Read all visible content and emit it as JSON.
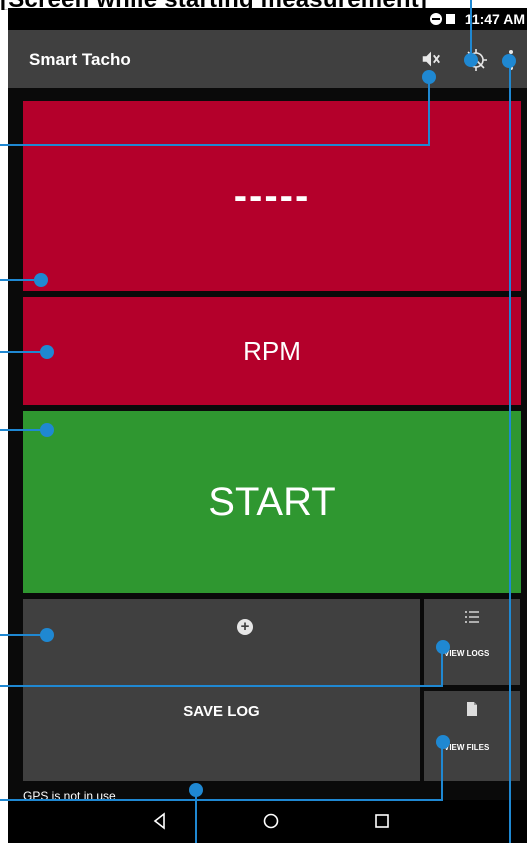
{
  "overlay_heading": "[Screen while starting measurement]",
  "status_bar": {
    "time": "11:47 AM"
  },
  "app_bar": {
    "title": "Smart Tacho",
    "icons": [
      "mute-icon",
      "gps-off-icon",
      "more-vert-icon"
    ]
  },
  "tiles": {
    "speed_value": "-----",
    "rpm_label": "RPM",
    "start_label": "START",
    "add_icon": "add-circle-icon",
    "save_log_label": "SAVE LOG",
    "view_logs_label": "VIEW LOGS",
    "view_files_label": "VIEW FILES"
  },
  "gps_note": "GPS is not in use",
  "nav_bar": {
    "buttons": [
      "back-icon",
      "home-icon",
      "recents-icon"
    ]
  },
  "colors": {
    "red_tile": "#b4002b",
    "green_tile": "#2f9730",
    "dark_tile": "#404040",
    "callout": "#1f88d2"
  }
}
